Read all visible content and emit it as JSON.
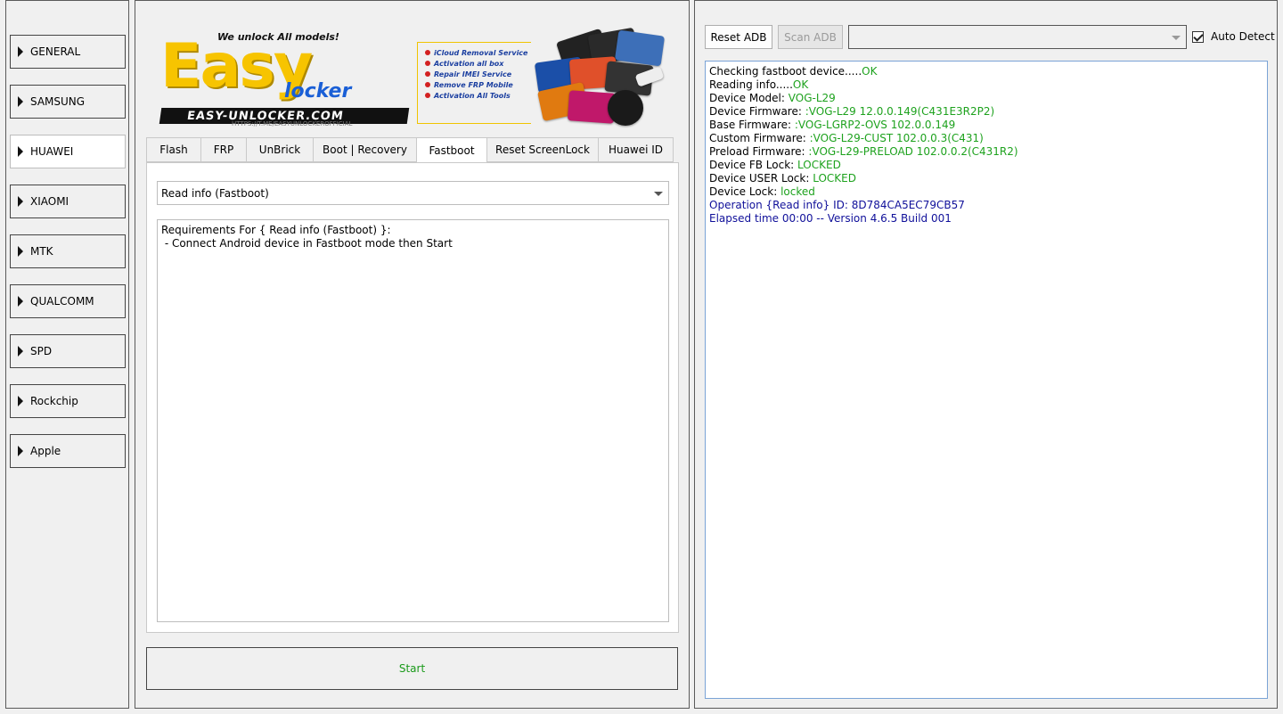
{
  "sidebar": {
    "items": [
      {
        "label": "GENERAL"
      },
      {
        "label": "SAMSUNG"
      },
      {
        "label": "HUAWEI",
        "active": true
      },
      {
        "label": "XIAOMI"
      },
      {
        "label": "MTK"
      },
      {
        "label": "QUALCOMM"
      },
      {
        "label": "SPD"
      },
      {
        "label": "Rockchip"
      },
      {
        "label": "Apple"
      }
    ]
  },
  "banner": {
    "tagline": "We unlock All models!",
    "logo_main": "Easy",
    "logo_sub": "locker",
    "site": "EASY-UNLOCKER.COM",
    "url": "HTTPS://T.ME/EASYUNLOCKEROFFICIAL",
    "services": [
      "iCloud Removal Service",
      "Activation all box",
      "Repair IMEI Service",
      "Remove FRP Mobile",
      "Activation All Tools"
    ]
  },
  "tabs": [
    {
      "label": "Flash"
    },
    {
      "label": "FRP"
    },
    {
      "label": "UnBrick"
    },
    {
      "label": "Boot | Recovery"
    },
    {
      "label": "Fastboot",
      "active": true
    },
    {
      "label": "Reset ScreenLock"
    },
    {
      "label": "Huawei ID"
    }
  ],
  "fastboot": {
    "operation": "Read info (Fastboot)",
    "requirements": "Requirements For { Read info (Fastboot) }:\n - Connect Android device in Fastboot mode then Start"
  },
  "start_button": "Start",
  "adb": {
    "reset_label": "Reset ADB",
    "scan_label": "Scan ADB",
    "device_value": "",
    "auto_detect_label": "Auto Detect",
    "auto_detect_checked": true
  },
  "log": [
    {
      "label": "Checking fastboot device.....",
      "value": "OK"
    },
    {
      "label": "Reading info.....",
      "value": "OK"
    },
    {
      "label": "Device Model: ",
      "value": "VOG-L29"
    },
    {
      "label": "Device Firmware: ",
      "value": ":VOG-L29 12.0.0.149(C431E3R2P2)"
    },
    {
      "label": "Base Firmware: ",
      "value": ":VOG-LGRP2-OVS 102.0.0.149"
    },
    {
      "label": "Custom Firmware: ",
      "value": ":VOG-L29-CUST 102.0.0.3(C431)"
    },
    {
      "label": "Preload Firmware: ",
      "value": ":VOG-L29-PRELOAD 102.0.0.2(C431R2)"
    },
    {
      "label": "Device FB Lock: ",
      "value": "LOCKED"
    },
    {
      "label": "Device USER Lock: ",
      "value": "LOCKED"
    },
    {
      "label": "Device Lock: ",
      "value": "locked"
    }
  ],
  "log_info": [
    "Operation {Read info} ID: 8D784CA5EC79CB57",
    "Elapsed time 00:00 -- Version 4.6.5 Build 001"
  ],
  "colors": {
    "ok_green": "#1ea21e",
    "info_blue": "#10109a",
    "start_green": "#1a9a1a",
    "log_border": "#7aa3d6"
  }
}
